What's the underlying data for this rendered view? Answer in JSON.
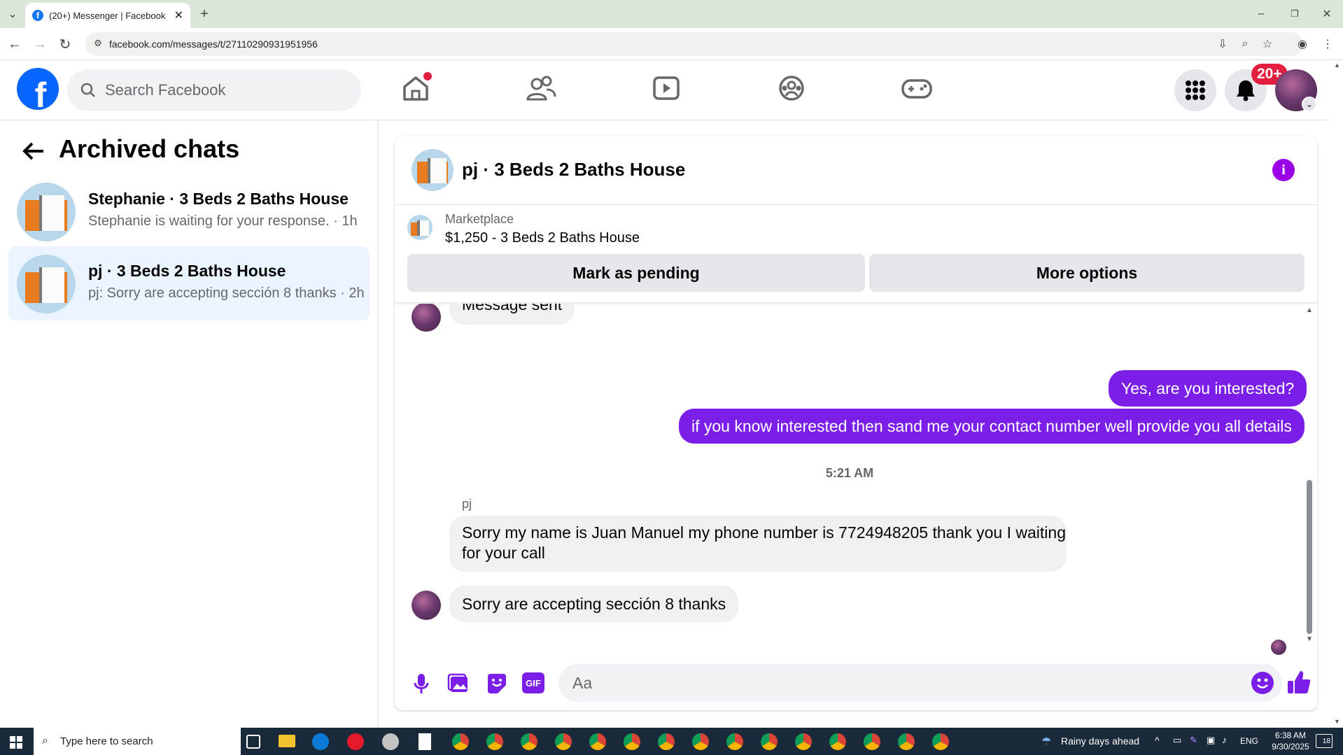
{
  "browser": {
    "tab_title": "(20+) Messenger | Facebook",
    "url": "facebook.com/messages/t/27110290931951956"
  },
  "fb": {
    "search_placeholder": "Search Facebook",
    "notifications_badge": "20+"
  },
  "left": {
    "title": "Archived chats",
    "chats": [
      {
        "name": "Stephanie · 3 Beds 2 Baths House",
        "preview": "Stephanie is waiting for your response. · 1h"
      },
      {
        "name": "pj · 3 Beds 2 Baths House",
        "preview": "pj: Sorry are accepting sección 8 thanks · 2h"
      }
    ]
  },
  "conversation": {
    "title": "pj · 3 Beds 2 Baths House",
    "marketplace_label": "Marketplace",
    "listing": "$1,250 - 3 Beds 2 Baths House",
    "mark_pending": "Mark as pending",
    "more_options": "More options",
    "partial_message": "Message sent",
    "messages_out": [
      "Yes, are you interested?",
      "if you know interested then sand me your contact number well provide you all details"
    ],
    "timestamp": "5:21 AM",
    "sender": "pj",
    "messages_in": [
      "Sorry my name is Juan Manuel my phone number is 7724948205  thank you I waiting",
      "for your call",
      "Sorry are accepting sección 8 thanks"
    ],
    "composer_placeholder": "Aa"
  },
  "taskbar": {
    "search_placeholder": "Type here to search",
    "weather": "Rainy days ahead",
    "lang": "ENG",
    "time": "6:38 AM",
    "date": "9/30/2025",
    "notif_count": "18"
  },
  "colors": {
    "fb_blue": "#0866ff",
    "accent_purple": "#7b1fe8",
    "notif_red": "#e41e3f",
    "selected_chat": "#ebf5ff"
  }
}
